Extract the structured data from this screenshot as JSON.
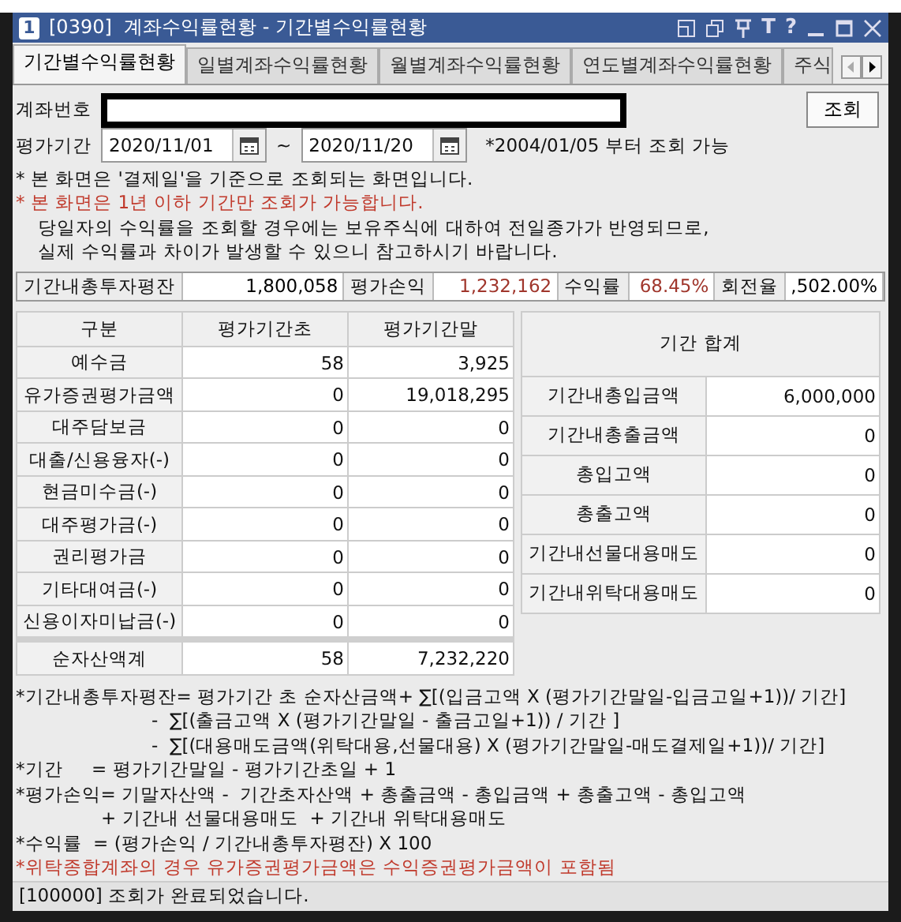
{
  "window": {
    "badge": "1",
    "title": "[0390]  계좌수익률현황 - 기간별수익률현황",
    "tool_labels": [
      "T",
      "?"
    ]
  },
  "tabs": [
    {
      "label": "기간별수익률현황",
      "selected": true
    },
    {
      "label": "일별계좌수익률현황",
      "selected": false
    },
    {
      "label": "월별계좌수익률현황",
      "selected": false
    },
    {
      "label": "연도별계좌수익률현황",
      "selected": false
    },
    {
      "label": "주식",
      "selected": false
    }
  ],
  "account": {
    "label": "계좌번호",
    "button": "조회"
  },
  "period": {
    "label": "평가기간",
    "start": "2020/11/01",
    "separator": "~",
    "end": "2020/11/20",
    "hint": "*2004/01/05 부터 조회 가능"
  },
  "notes": [
    {
      "kind": "normal",
      "text": "* 본 화면은 '결제일'을 기준으로 조회되는 화면입니다."
    },
    {
      "kind": "warning",
      "text": "* 본 화면은 1년 이하 기간만 조회가 가능합니다."
    },
    {
      "kind": "indented",
      "text": "당일자의 수익률을 조회할 경우에는 보유주식에 대하여 전일종가가 반영되므로,"
    },
    {
      "kind": "indented",
      "text": "실제 수익률과 차이가 발생할 수 있으니 참고하시기 바랍니다."
    }
  ],
  "summary": [
    {
      "label": "기간내총투자평잔",
      "value": "1,800,058",
      "color": "#000000"
    },
    {
      "label": "평가손익",
      "value": "1,232,162",
      "color": "#a0362c"
    },
    {
      "label": "수익률",
      "value": "68.45%",
      "color": "#a0362c"
    },
    {
      "label": "회전율",
      "value": ",502.00%",
      "color": "#000000"
    }
  ],
  "assets_table": {
    "columns": [
      "구분",
      "평가기간초",
      "평가기간말"
    ],
    "rows": [
      [
        "예수금",
        "58",
        "3,925"
      ],
      [
        "유가증권평가금액",
        "0",
        "19,018,295"
      ],
      [
        "대주담보금",
        "0",
        "0"
      ],
      [
        "대출/신용융자(-)",
        "0",
        "0"
      ],
      [
        "현금미수금(-)",
        "0",
        "0"
      ],
      [
        "대주평가금(-)",
        "0",
        "0"
      ],
      [
        "권리평가금",
        "0",
        "0"
      ],
      [
        "기타대여금(-)",
        "0",
        "0"
      ],
      [
        "신용이자미납금(-)",
        "0",
        "0"
      ]
    ],
    "total": [
      "순자산액계",
      "58",
      "7,232,220"
    ]
  },
  "period_totals": {
    "title": "기간 합계",
    "rows": [
      [
        "기간내총입금액",
        "6,000,000"
      ],
      [
        "기간내총출금액",
        "0"
      ],
      [
        "총입고액",
        "0"
      ],
      [
        "총출고액",
        "0"
      ],
      [
        "기간내선물대용매도",
        "0"
      ],
      [
        "기간내위탁대용매도",
        "0"
      ]
    ]
  },
  "formulas": [
    {
      "kind": "main",
      "text": "*기간내총투자평잔= 평가기간 초 순자산금액+ ∑[(입금고액 X (평가기간말일-입금고일+1))/ 기간]"
    },
    {
      "kind": "continuation",
      "text": "-  ∑[(출금고액 X (평가기간말일 - 출금고일+1)) / 기간 ]"
    },
    {
      "kind": "continuation",
      "text": "-  ∑[(대용매도금액(위탁대용,선물대용) X (평가기간말일-매도결제일+1))/ 기간]"
    },
    {
      "kind": "main",
      "text": "*기간     = 평가기간말일 - 평가기간초일 + 1"
    },
    {
      "kind": "main",
      "text": "*평가손익= 기말자산액 -  기간초자산액 + 총출금액 - 총입금액 + 총출고액 - 총입고액"
    },
    {
      "kind": "sub",
      "text": "+ 기간내 선물대용매도  + 기간내 위탁대용매도"
    },
    {
      "kind": "main",
      "text": "*수익률  = (평가손익 / 기간내총투자평잔) X 100"
    },
    {
      "kind": "warning",
      "text": "*위탁종합계좌의 경우 유가증권평가금액은 수익증권평가금액이 포함됨"
    }
  ],
  "status_bar": {
    "text": "[100000] 조회가 완료되었습니다."
  }
}
